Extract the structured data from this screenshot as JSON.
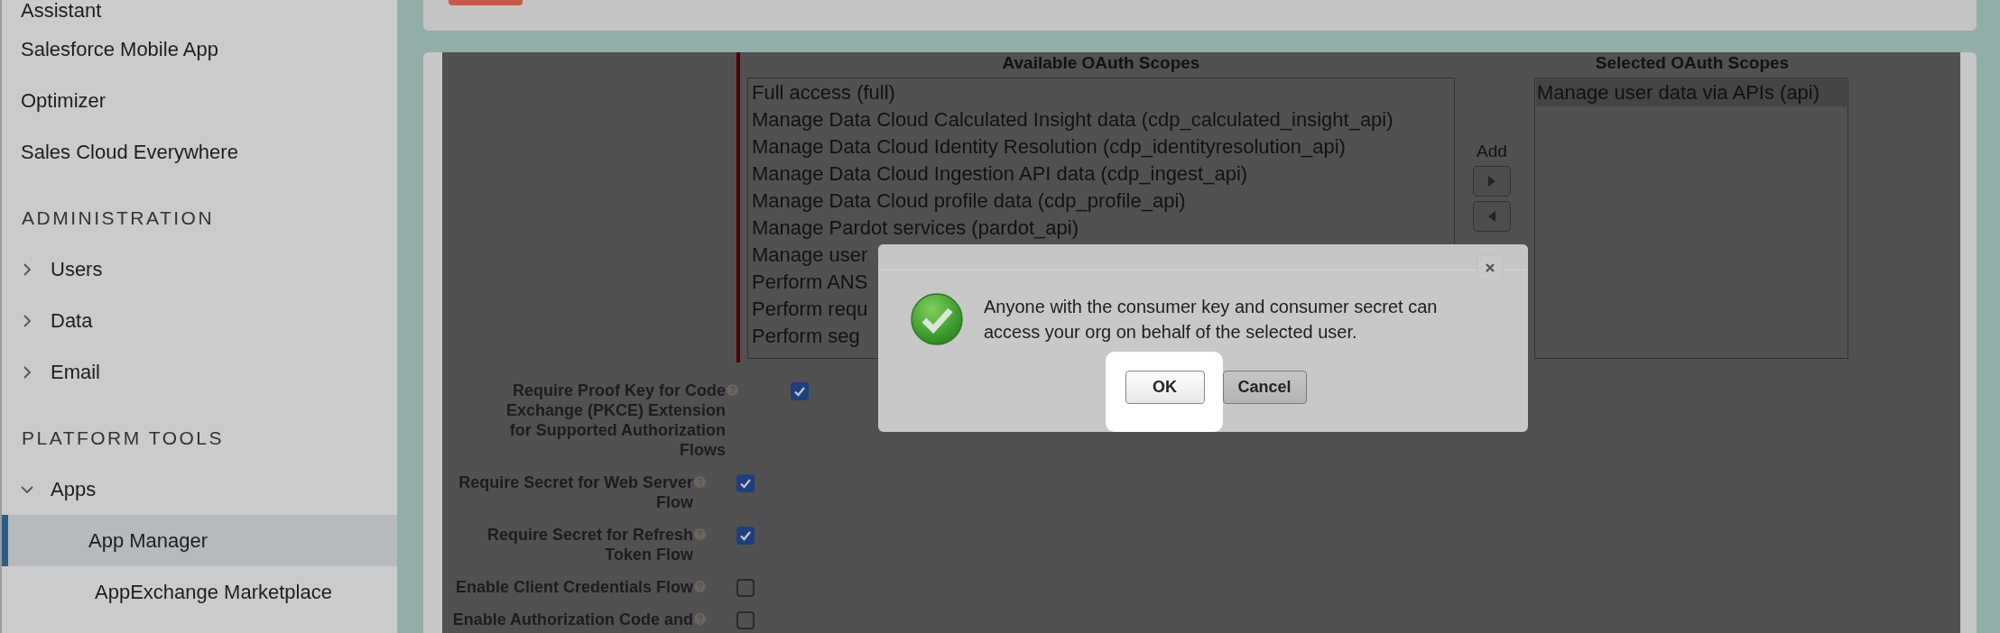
{
  "sidebar": {
    "items": [
      {
        "kind": "link",
        "label": "Assistant"
      },
      {
        "kind": "link",
        "label": "Salesforce Mobile App"
      },
      {
        "kind": "link",
        "label": "Optimizer"
      },
      {
        "kind": "link",
        "label": "Sales Cloud Everywhere"
      },
      {
        "kind": "header",
        "label": "ADMINISTRATION"
      },
      {
        "kind": "group",
        "label": "Users",
        "expanded": false
      },
      {
        "kind": "group",
        "label": "Data",
        "expanded": false
      },
      {
        "kind": "group",
        "label": "Email",
        "expanded": false
      },
      {
        "kind": "header",
        "label": "PLATFORM TOOLS"
      },
      {
        "kind": "group",
        "label": "Apps",
        "expanded": true
      },
      {
        "kind": "child",
        "label": "App Manager",
        "selected": true
      },
      {
        "kind": "child",
        "label": "AppExchange Marketplace",
        "selected": false
      }
    ]
  },
  "scopes": {
    "available_title": "Available OAuth Scopes",
    "available": [
      "Full access (full)",
      "Manage Data Cloud Calculated Insight data (cdp_calculated_insight_api)",
      "Manage Data Cloud Identity Resolution (cdp_identityresolution_api)",
      "Manage Data Cloud Ingestion API data (cdp_ingest_api)",
      "Manage Data Cloud profile data (cdp_profile_api)",
      "Manage Pardot services (pardot_api)",
      "Manage user",
      "Perform ANS",
      "Perform requ",
      "Perform seg"
    ],
    "add_label": "Add",
    "selected_title": "Selected OAuth Scopes",
    "selected": [
      {
        "label": "Manage user data via APIs (api)",
        "selected": true
      }
    ]
  },
  "options": [
    {
      "label": "Require Proof Key for Code Exchange (PKCE) Extension for Supported Authorization Flows",
      "checked": true
    },
    {
      "label": "Require Secret for Web Server Flow",
      "checked": true
    },
    {
      "label": "Require Secret for Refresh Token Flow",
      "checked": true
    },
    {
      "label": "Enable Client Credentials Flow",
      "checked": false
    },
    {
      "label": "Enable Authorization Code and",
      "checked": false
    }
  ],
  "dialog": {
    "message": "Anyone with the consumer key and consumer secret can access your org on behalf of the selected user.",
    "buttons": [
      {
        "label": "OK",
        "focused": true
      },
      {
        "label": "Cancel",
        "focused": false
      }
    ]
  }
}
